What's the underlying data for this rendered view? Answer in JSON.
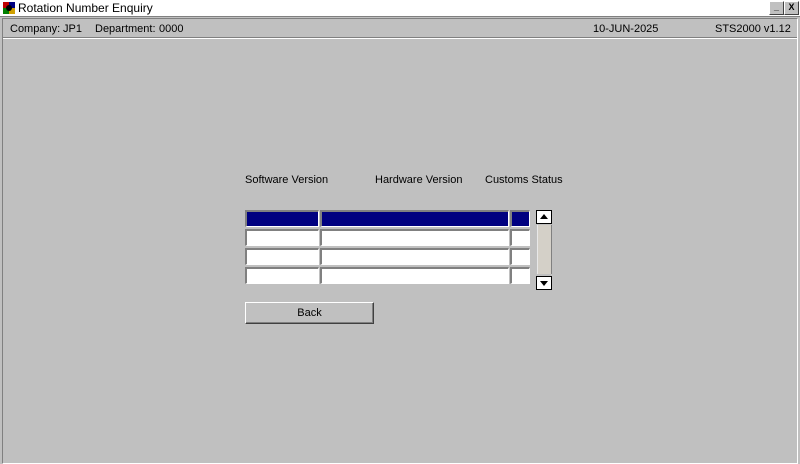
{
  "window": {
    "title": "Rotation Number Enquiry",
    "minimize_glyph": "_",
    "close_glyph": "X"
  },
  "status": {
    "company_label": "Company:",
    "company": "JP1",
    "department_label": "Department:",
    "department": "0000",
    "date": "10-JUN-2025",
    "version": "STS2000  v1.12"
  },
  "columns": {
    "software": "Software Version",
    "hardware": "Hardware Version",
    "customs": "Customs Status"
  },
  "rows": [
    {
      "software": "",
      "hardware": "",
      "customs": "",
      "selected": true
    },
    {
      "software": "",
      "hardware": "",
      "customs": "",
      "selected": false
    },
    {
      "software": "",
      "hardware": "",
      "customs": "",
      "selected": false
    },
    {
      "software": "",
      "hardware": "",
      "customs": "",
      "selected": false
    }
  ],
  "buttons": {
    "back": "Back"
  },
  "colors": {
    "background": "#c0c0c0",
    "selection": "#000080"
  },
  "icons": {
    "app": "app-icon",
    "scroll_up": "arrow-up-icon",
    "scroll_down": "arrow-down-icon"
  }
}
